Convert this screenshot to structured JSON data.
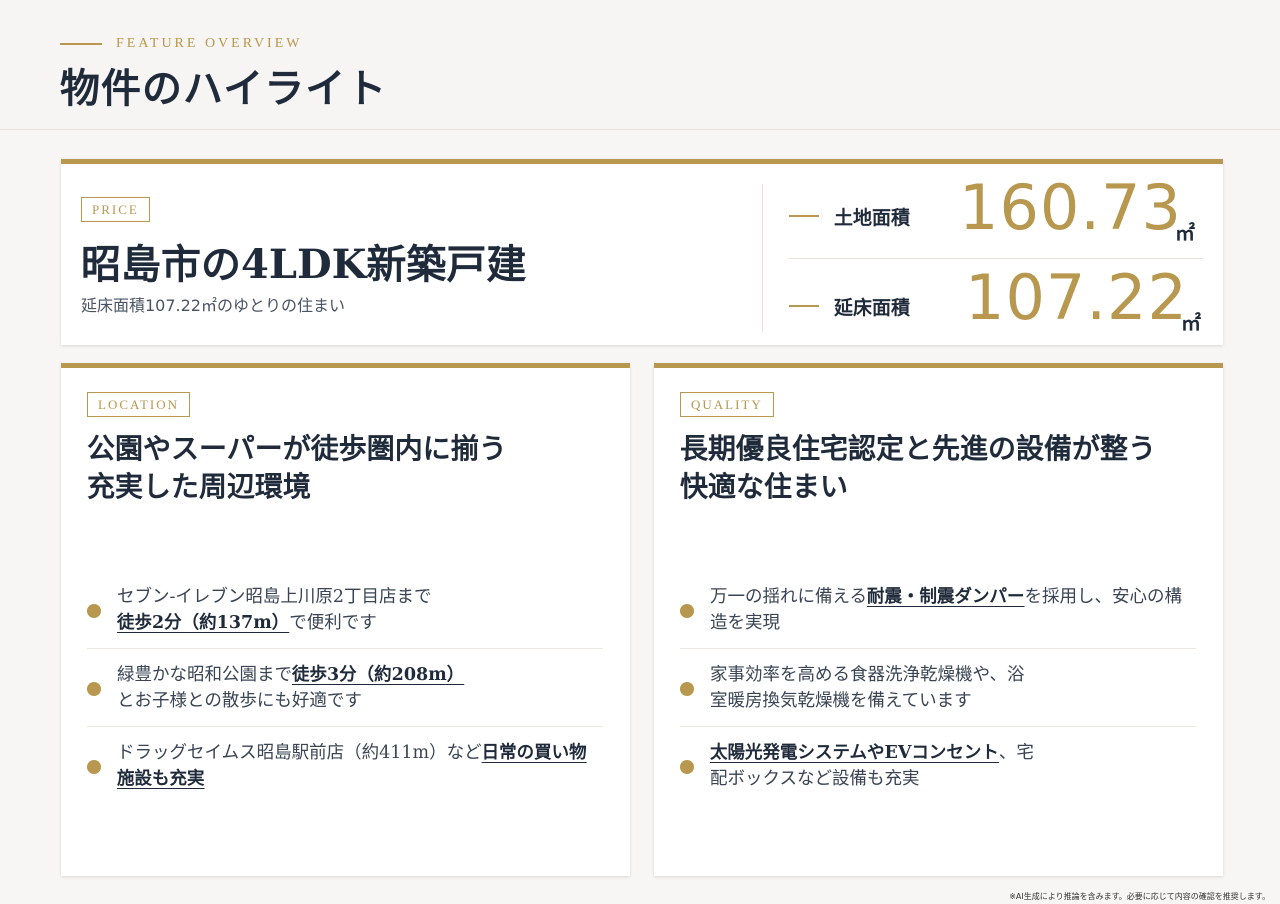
{
  "header": {
    "eyebrow": "FEATURE OVERVIEW",
    "title": "物件のハイライト"
  },
  "price": {
    "label": "PRICE",
    "title": "昭島市の4LDK新築戸建",
    "subtitle": "延床面積107.22㎡のゆとりの住まい",
    "stats": [
      {
        "label": "土地面積",
        "value": "160.73",
        "unit": "㎡"
      },
      {
        "label": "延床面積",
        "value": "107.22",
        "unit": "㎡"
      }
    ]
  },
  "location": {
    "label": "LOCATION",
    "title_line1": "公園やスーパーが徒歩圏内に揃う",
    "title_line2": "充実した周辺環境",
    "items": [
      {
        "pre": "セブン-イレブン昭島上川原2丁目店まで",
        "hl": "徒歩2分（約137m）",
        "post": "で便利です"
      },
      {
        "pre": "緑豊かな昭和公園まで",
        "hl": "徒歩3分（約208m）",
        "post": "とお子様との散歩にも好適です"
      },
      {
        "pre": "ドラッグセイムス昭島駅前店（約411m）など",
        "hl": "日常の買い物施設も充実",
        "post": ""
      }
    ]
  },
  "quality": {
    "label": "QUALITY",
    "title_line1": "長期優良住宅認定と先進の設備が整う",
    "title_line2": "快適な住まい",
    "items": [
      {
        "pre": "万一の揺れに備える",
        "hl": "耐震・制震ダンパー",
        "post": "を採用し、安心の構造を実現"
      },
      {
        "pre": "家事効率を高める食器洗浄乾燥機や、浴室暖房換気乾燥機を備えています",
        "hl": "",
        "post": ""
      },
      {
        "pre": "",
        "hl": "太陽光発電システムやEVコンセント",
        "post": "、宅配ボックスなど設備も充実"
      }
    ]
  },
  "footnote": "※AI生成により推論を含みます。必要に応じて内容の確認を推奨します。"
}
